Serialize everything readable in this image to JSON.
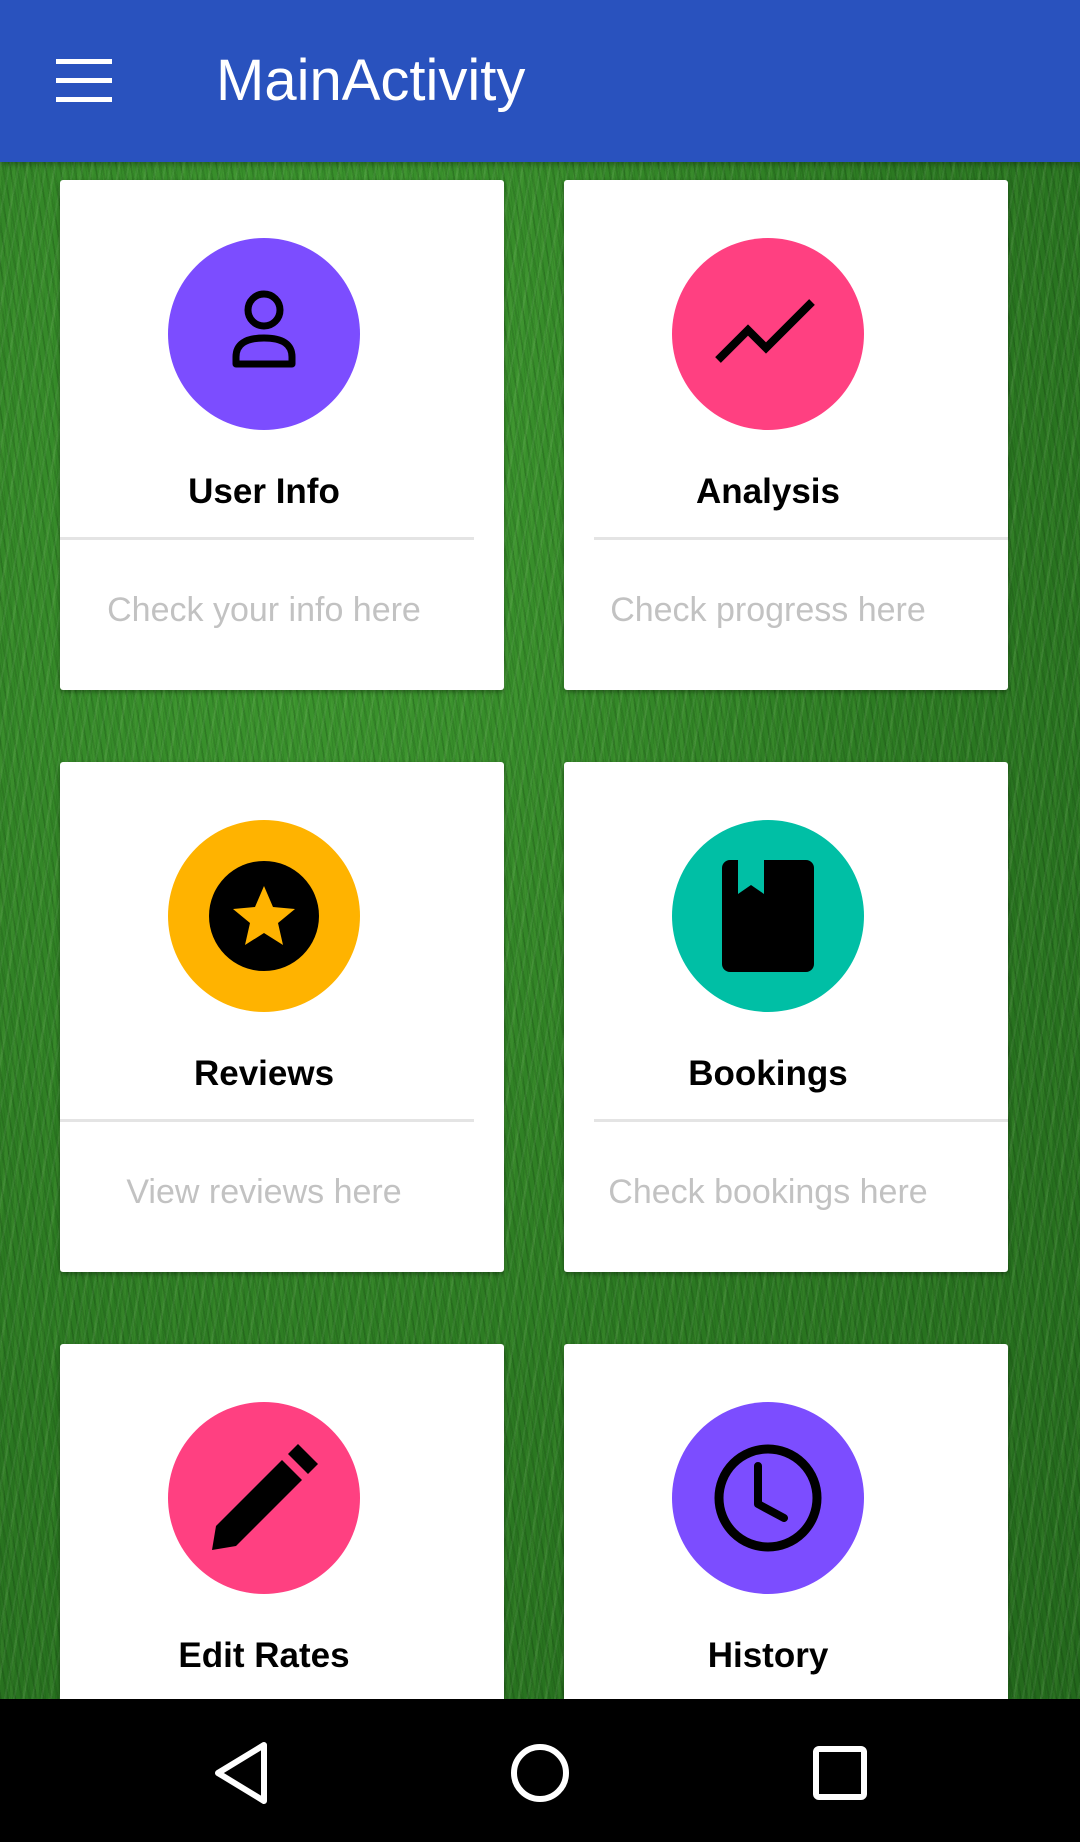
{
  "app_bar": {
    "title": "MainActivity",
    "background_color": "#2952be",
    "menu_icon": "hamburger-menu-icon"
  },
  "cards": [
    {
      "title": "User Info",
      "subtitle": "Check your info here",
      "icon": "person-icon",
      "icon_bg": "#7c4dff"
    },
    {
      "title": "Analysis",
      "subtitle": "Check progress here",
      "icon": "trending-up-icon",
      "icon_bg": "#ff4081"
    },
    {
      "title": "Reviews",
      "subtitle": "View reviews here",
      "icon": "star-icon",
      "icon_bg": "#ffb300"
    },
    {
      "title": "Bookings",
      "subtitle": "Check bookings here",
      "icon": "book-icon",
      "icon_bg": "#00bfa5"
    },
    {
      "title": "Edit Rates",
      "subtitle": "",
      "icon": "pencil-icon",
      "icon_bg": "#ff4081"
    },
    {
      "title": "History",
      "subtitle": "",
      "icon": "clock-icon",
      "icon_bg": "#7c4dff"
    }
  ],
  "nav_bar": {
    "buttons": [
      "back-icon",
      "home-icon",
      "recents-icon"
    ]
  }
}
